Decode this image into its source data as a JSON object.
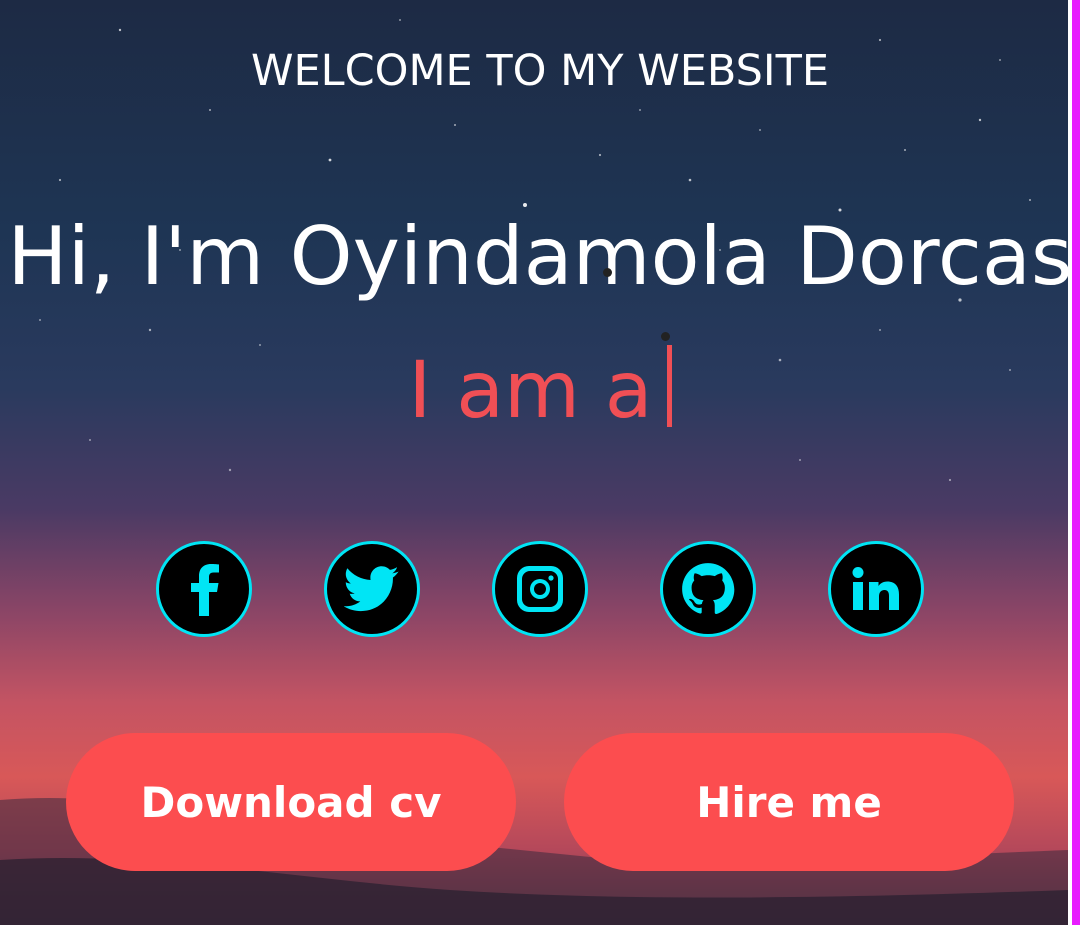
{
  "hero": {
    "welcome": "WELCOME TO MY WEBSITE",
    "greeting": "Hi, I'm Oyindamola Dorcas",
    "typed_prefix": "I am a"
  },
  "socials": [
    {
      "name": "facebook-icon",
      "glyph": "f"
    },
    {
      "name": "twitter-icon"
    },
    {
      "name": "instagram-icon"
    },
    {
      "name": "github-icon"
    },
    {
      "name": "linkedin-icon",
      "glyph": "in"
    }
  ],
  "buttons": {
    "download_cv": "Download cv",
    "hire_me": "Hire me"
  },
  "colors": {
    "accent": "#fc4d4f",
    "typed_text": "#f04f55",
    "icon_ring": "#00e5f5",
    "icon_bg": "#000000",
    "edge_line": "#e81cff"
  }
}
